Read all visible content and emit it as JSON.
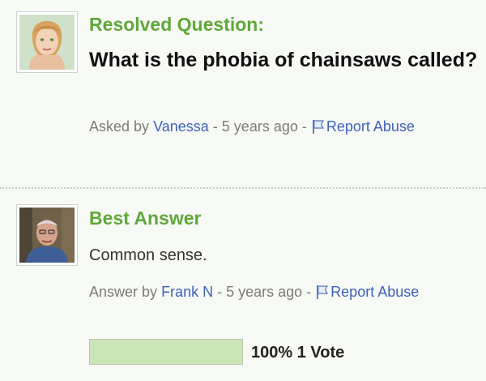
{
  "question": {
    "header": "Resolved Question:",
    "title": "What is the phobia of chainsaws called?",
    "meta": {
      "prefix": "Asked by",
      "author": "Vanessa",
      "time": "- 5 years ago -",
      "report_label": "Report Abuse"
    }
  },
  "answer": {
    "header": "Best Answer",
    "text": "Common sense.",
    "meta": {
      "prefix": "Answer by",
      "author": "Frank N",
      "time": "- 5 years ago -",
      "report_label": "Report Abuse"
    },
    "vote": {
      "fraction": 1.0,
      "label": "100% 1 Vote"
    }
  },
  "icons": {
    "asker_avatar": "avatar-icon",
    "answerer_avatar": "avatar-icon",
    "report": "flag-icon"
  },
  "colors": {
    "accent_green": "#5fa83a",
    "link_blue": "#3d62b8",
    "meta_gray": "#7b7b7b",
    "vote_fill": "#cbe5b8"
  }
}
